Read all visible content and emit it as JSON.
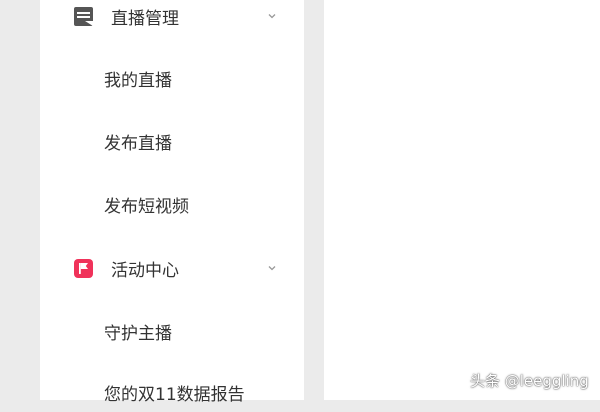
{
  "sidebar": {
    "sections": [
      {
        "icon": "live-manage-icon",
        "label": "直播管理",
        "items": [
          "我的直播",
          "发布直播",
          "发布短视频"
        ]
      },
      {
        "icon": "flag-icon",
        "label": "活动中心",
        "items": [
          "守护主播",
          "您的双11数据报告"
        ]
      }
    ]
  },
  "colors": {
    "text": "#333333",
    "live_icon": "#555555",
    "activity_icon": "#f0325a",
    "page_bg": "#ebebeb"
  },
  "watermark": "头条 @leeggling"
}
